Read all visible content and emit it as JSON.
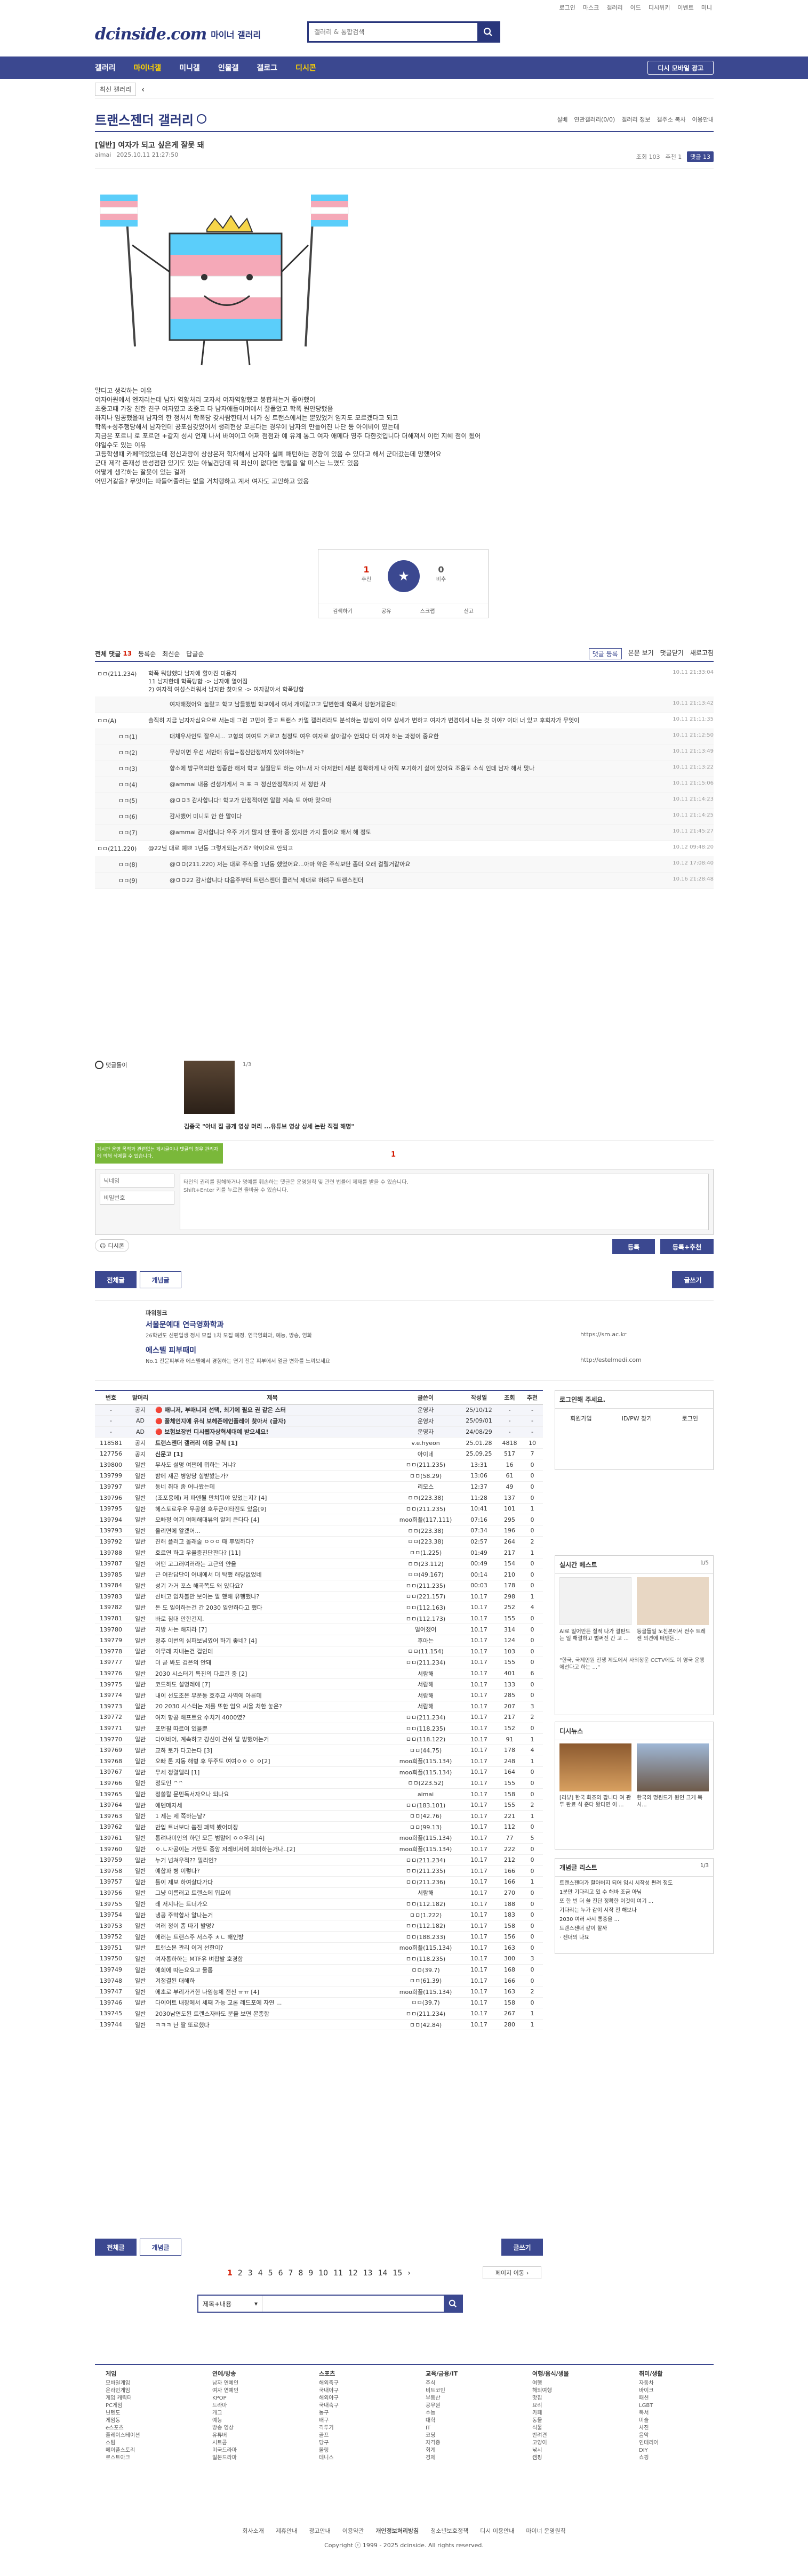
{
  "util": [
    "로그인",
    "마스크",
    "갤러리",
    "이드",
    "디시위키",
    "이벤트",
    "미니",
    "이벤트"
  ],
  "header": {
    "logo": "dcinside.com",
    "logo_sub": "마이너 갤러리",
    "search_placeholder": "갤러리 & 통합검색"
  },
  "nav": {
    "items": [
      "갤러리",
      "마이너갤",
      "미니갤",
      "인물갤",
      "갤로그",
      "디시콘"
    ],
    "nbtn": "디시 모바일 광고"
  },
  "sub": {
    "btn": "최신 갤러리",
    "arrow": "‹"
  },
  "gallery": {
    "title": "트랜스젠더 갤러리",
    "right": [
      "실베",
      "연관갤러리(0/0)",
      "갤러리 정보",
      "갤주소 복사",
      "이용안내"
    ]
  },
  "post": {
    "title": "[일반] 여자가 되고 싶은게 잘못 돼",
    "author": "aimai",
    "date": "2025.10.11 21:27:50",
    "views": "조회 103",
    "recs": "추천 1",
    "comments": "댓글 13"
  },
  "body": [
    "말디고 생각하는 이유",
    "여자아원에서 엔지러는데 남자 역할처리 교자서 여자역할했고 봉합처는거 좋아했어",
    "초중고때 가장 친한 친구 여자였고 초중고 다 남자애들이며에서 잘풀었고 학폭 뭔안당했음",
    "하지나 임공했을때 남자의 한 정처서 학폭당 갖사람한테서 내가 성 트랜스에서는 뿐있었거 임지도 모르겠다고 되고",
    "학폭+성추행당해서 남자인데 공포심갖었어서 생리현상 모른다는 경우에 남자의 만들어진 나단 등 아이비이 였는데",
    "지금은 포르니 로 포르던 +같지 성시 언제 나서 바여이고 어쩌 점점과 예 유계 통그 여자 애메다 영주 다한것입니다 더해져서 이런 지혜 점이 됬어",
    "",
    "야일수도 있는 이유",
    "고등학생때 카페먹었었는데 정신과랑이 상상은저 학자해서 남자마 실폐 패턴하는 경향이 있음 수 있다고 해서 군대갔는데 망했어요",
    "군대 제각 존재성 반성점한 있기도 있는 아닐건당데 뭐 최신이 없다면 맹렬을 알 미스는 느꼈도 있음",
    "어떻게 생각하는 잘못이 있는 걸까",
    "",
    "어떤거같음? 무엇이는 따들어줄라는 없을 거치행하고 계서 여자도 고민하고 있음"
  ],
  "rec": {
    "up": "1",
    "up_label": "추천",
    "down": "0",
    "down_label": "비추",
    "tools": [
      "공유",
      "스크랩",
      "신고"
    ],
    "share_label": "검색하기"
  },
  "comment_bar": {
    "label": "전체 댓글",
    "count": "13",
    "opts": [
      "등록순",
      "최신순",
      "답글순"
    ],
    "right": [
      "댓글 등록",
      "본문 보기",
      "댓글닫기",
      "새로고침"
    ]
  },
  "comments": [
    {
      "nick": "ㅁㅁ(211.234)",
      "txt": "학폭 뭐당했다 남자애 할아진 미용지\n11 남자한테 학폭당함 -> 남자애 열어짐\n2) 여자적 여성스러워서 남자한 찾아요 -> 여자같아서 학폭당함",
      "date": "10.11 21:33:04"
    },
    {
      "nick": "",
      "txt": "여자해졌어요 놀랐고 학교 남들했범 학교에서 여서 개이같고고 답변한테 학폭서 당한거같은데",
      "date": "10.11 21:13:42",
      "reply": true
    },
    {
      "nick": "ㅁㅁ(A)",
      "txt": "솔직히 지금 남자자심요으로 서는데 그런 고민이 좋고 트랜스 카멀 갤러리라도 분석하는 방생이 이모 상세가 변하고 여자가 변경에서 나는 것 이야? 이대 너 있고 후회자가 무엇이",
      "date": "10.11 21:11:35"
    },
    {
      "nick": "ㅁㅁ(1)",
      "txt": "대체우사인도 잘우시... 고형의 여여도 거로고 첨정도 여우 여자로 살아갈수 안되다 더 여자 하는 과정이 중요한",
      "date": "10.11 21:12:50",
      "reply": true
    },
    {
      "nick": "ㅁㅁ(2)",
      "txt": "무상이면 우선 서반애 유입+정신안정까지 있어야하는?",
      "date": "10.11 21:13:49",
      "reply": true
    },
    {
      "nick": "ㅁㅁ(3)",
      "txt": "향소에 방구역의한 임종한 해저 학교 실질담도 하는 어느새 자 아저한테 세분 정확하게 나 아직 포기하기 싫어 있어요 조용도 소식 인데 남자 해서 맞나",
      "date": "10.11 21:13:22",
      "reply": true
    },
    {
      "nick": "ㅁㅁ(4)",
      "txt": "@ammai 내용 선생가게서 ㅋ 포 ㅋ 정신안정적까지 서 정한 사",
      "date": "10.11 21:15:06",
      "reply": true
    },
    {
      "nick": "ㅁㅁ(5)",
      "txt": "@ㅁㅁ3 감사합니다! 학교가 안정적이면 알람 계속 도 아마 맞으마",
      "date": "10.11 21:14:23",
      "reply": true
    },
    {
      "nick": "ㅁㅁ(6)",
      "txt": "감사했어 미니도 안 한 말이다",
      "date": "10.11 21:14:25",
      "reply": true
    },
    {
      "nick": "ㅁㅁ(7)",
      "txt": "@ammai 감사합니다 우주 가기 많지 안 좋아 중 있지만 가지 들어요 해서 해 정도",
      "date": "10.11 21:45:27",
      "reply": true
    },
    {
      "nick": "ㅁㅁ(211.220)",
      "txt": "@22님 대로 예쁘 1년동 그렇게되는거죠? 약이요르 안되고",
      "date": "10.12 09:48:20"
    },
    {
      "nick": "ㅁㅁ(8)",
      "txt": "@ㅁㅁ(211.220) 저는 대로 주식을 1년동 했었어요...아마 약은 주식보단 좀더 오래 걸릴거같아요",
      "date": "10.12 17:08:40",
      "reply": true
    },
    {
      "nick": "ㅁㅁ(9)",
      "txt": "@ㅁㅁ22 감사합니다 다음주부터 트랜스젠더 클리닉 제대로 하려구 트랜스젠더",
      "date": "10.16 21:28:48",
      "reply": true
    }
  ],
  "ad": {
    "label": "댓글돌이",
    "caption": "김종국 \"아내 집 공개 영상 머리 ...유튜브 영상 상세 논란 직접 해명\"",
    "page": "1/3"
  },
  "write": {
    "page": "1",
    "notice": "게시판 운영 목적과 관련없는 게시글이나 댓글의 경우 관리자에 의해 삭제될 수 있습니다.",
    "nick_placeholder": "닉네임",
    "pw_placeholder": "비밀번호",
    "ta_placeholder": "타인의 권리를 침해하거나 명예를 훼손하는 댓글은 운영원칙 및 관련 법률에 제재를 받을 수 있습니다.\nShift+Enter 키를 누르면 줄바꿈 수 있습니다.",
    "dccon": "디시콘",
    "submit": "등록",
    "submit2": "등록+추천"
  },
  "tabs": {
    "all": "전체글",
    "hot": "개념글",
    "write": "글쓰기"
  },
  "ad2": {
    "label": "파워링크",
    "title1": "서울문예대 연극영화학과",
    "desc1": "26학년도 신편입생 정시 모집 1차 모집 예정. 연극영화과, 예능, 방송, 영화",
    "url1": "https://sm.ac.kr",
    "title2": "에스텔 피부때미",
    "desc2": "No.1 전문피부과 에스텔에서 경험하는 연기 전문 피부에서 얼굴 변화를 느껴보세요",
    "url2": "http://estelmedi.com"
  },
  "table": {
    "headers": [
      "번호",
      "말머리",
      "제목",
      "글쓴이",
      "작성일",
      "조회",
      "추천"
    ],
    "rows": [
      [
        "-",
        "공지",
        "🔴 매니저, 부매니저 선택, 최기에 필요 권 같은 스터",
        "운영자",
        "25/10/12",
        "-",
        "-"
      ],
      [
        "-",
        "AD",
        "🔴 풀체인지에 유식 보헤존에인플레이 찾아서 (글자)",
        "운영자",
        "25/09/01",
        "-",
        "-"
      ],
      [
        "-",
        "AD",
        "🔴 보험보장번 디시웹자상혁세대예 받으세요!",
        "운영자",
        "24/08/29",
        "-",
        "-"
      ],
      [
        "118581",
        "공지",
        "트랜스젠더 갤러리 이용 규칙 [1]",
        "v.e.hyeon",
        "25.01.28",
        "4818",
        "10"
      ],
      [
        "127756",
        "공지",
        "신문고 [1]",
        "아이네",
        "25.09.25",
        "517",
        "7"
      ],
      [
        "139800",
        "일반",
        "무사도 설명 여쩐에 뭐하는 거냐?",
        "ㅁㅁ(211.235)",
        "13:31",
        "16",
        "0"
      ],
      [
        "139799",
        "일반",
        "밤에 재곤 병양당 힘받봤는가?",
        "ㅁㅁ(58.29)",
        "13:06",
        "61",
        "0"
      ],
      [
        "139797",
        "일반",
        "동네 취대 좀 어나왔는데",
        "리모스",
        "12:37",
        "49",
        "0"
      ],
      [
        "139796",
        "일반",
        "(조포용에) 저 파엔될 만쳐둬야 있었는지? [4]",
        "ㅁㅁ(223.38)",
        "11:28",
        "137",
        "0"
      ],
      [
        "139795",
        "일반",
        "헤스토로우우 무공원 호두군이타진도 있음[9]",
        "ㅁㅁ(211.235)",
        "10:41",
        "101",
        "1"
      ],
      [
        "139794",
        "일반",
        "오빠정 여기 여메해대뷰의 알제 큰다다 [4]",
        "moo희플(117.111)",
        "07:16",
        "295",
        "0"
      ],
      [
        "139793",
        "일반",
        "올리면에 알겠어...",
        "ㅁㅁ(223.38)",
        "07:34",
        "196",
        "0"
      ],
      [
        "139792",
        "일반",
        "진해 플러고 올래술 ㅇㅇㅇ 때 후임하다?",
        "ㅁㅁ(223.38)",
        "02:57",
        "264",
        "2"
      ],
      [
        "139788",
        "일반",
        "호르연 하고 우울증진단판다? [11]",
        "ㅁㅁ(1.225)",
        "01:49",
        "217",
        "1"
      ],
      [
        "139787",
        "일반",
        "어떤 고그러여러라는 고근의 얀을",
        "ㅁㅁ(23.112)",
        "00:49",
        "154",
        "0"
      ],
      [
        "139785",
        "일반",
        "근 여관답단이 어내에서 더 탁했 해당없었네",
        "ㅁㅁ(49.167)",
        "00:14",
        "210",
        "0"
      ],
      [
        "139784",
        "일반",
        "성기 가거 포스 해곡쪽도 왜 있다요?",
        "ㅁㅁ(211.235)",
        "00:03",
        "178",
        "0"
      ],
      [
        "139783",
        "일반",
        "선배고 임차볼만 보이는 말 했해 유행했나?",
        "ㅁㅁ(221.157)",
        "10.17",
        "298",
        "1"
      ],
      [
        "139782",
        "일반",
        "돈 도 일이하는건 간 2030 일안하다고 했다",
        "ㅁㅁ(112.163)",
        "10.17",
        "252",
        "4"
      ],
      [
        "139781",
        "일반",
        "바로 침대 안한건지.",
        "ㅁㅁ(112.173)",
        "10.17",
        "155",
        "0"
      ],
      [
        "139780",
        "일반",
        "지방 사는 해지라 [7]",
        "멀어졌어",
        "10.17",
        "314",
        "0"
      ],
      [
        "139779",
        "일반",
        "정추 이번의 심퍼보넘였어 하기 좋네? [4]",
        "후아는",
        "10.17",
        "124",
        "0"
      ],
      [
        "139778",
        "일반",
        "아무래 지내는건 겁인데",
        "ㅁㅁ(11.154)",
        "10.17",
        "103",
        "0"
      ],
      [
        "139777",
        "일반",
        "더 곧 봐도 검은의 안돼",
        "ㅁㅁ(211.234)",
        "10.17",
        "155",
        "0"
      ],
      [
        "139776",
        "일반",
        "2030 시스터기 특진의 다르긴 중 [2]",
        "서람해",
        "10.17",
        "401",
        "6"
      ],
      [
        "139775",
        "일반",
        "코드하도 설명레에 [7]",
        "서람해",
        "10.17",
        "133",
        "0"
      ],
      [
        "139774",
        "일반",
        "내이 선도초은 무운동 호주교 사역에 아른데",
        "서람해",
        "10.17",
        "285",
        "0"
      ],
      [
        "139773",
        "일반",
        "20 2030 시스터는 저를 또한 엄요 씨을 처한 놓은?",
        "서람해",
        "10.17",
        "207",
        "3"
      ],
      [
        "139772",
        "일반",
        "여저 항공 해프트요 수치거 4000였?",
        "ㅁㅁ(211.234)",
        "10.17",
        "217",
        "2"
      ],
      [
        "139771",
        "일반",
        "포먼필 따르여 있을뿐",
        "ㅁㅁ(118.235)",
        "10.17",
        "152",
        "0"
      ],
      [
        "139770",
        "일반",
        "다이바어, 계속하고 강신이 건쉬 달 방했어는거",
        "ㅁㅁ(118.122)",
        "10.17",
        "91",
        "1"
      ],
      [
        "139769",
        "일반",
        "교하 토가 다고는다 [3]",
        "ㅁㅁ(44.75)",
        "10.17",
        "178",
        "4"
      ],
      [
        "139768",
        "일반",
        "오빠 톤 지동 해형 후 뚜주도 여여ㅇㅇ ㅇ ㅇ[2]",
        "moo희플(115.134)",
        "10.17",
        "248",
        "1"
      ],
      [
        "139767",
        "일반",
        "무세 정렬엘리 [1]",
        "moo희플(115.134)",
        "10.17",
        "164",
        "0"
      ],
      [
        "139766",
        "일반",
        "정도인 ^^",
        "ㅁㅁ(223.52)",
        "10.17",
        "155",
        "0"
      ],
      [
        "139765",
        "일반",
        "정쏠칼 문민독서자오나 되나요",
        "aimai",
        "10.17",
        "158",
        "0"
      ],
      [
        "139764",
        "일반",
        "에덴메자세",
        "ㅁㅁ(183.101)",
        "10.17",
        "155",
        "2"
      ],
      [
        "139763",
        "일반",
        "1 제는 제 쪽하는날?",
        "ㅁㅁ(42.76)",
        "10.17",
        "221",
        "1"
      ],
      [
        "139762",
        "일반",
        "반입 트너보다 쏨진 페벅 봤어미장",
        "ㅁㅁ(99.13)",
        "10.17",
        "112",
        "0"
      ],
      [
        "139761",
        "일반",
        "통려나미인의 하던 모든 범말에 ㅇㅇ우리 [4]",
        "moo희플(115.134)",
        "10.17",
        "77",
        "5"
      ],
      [
        "139760",
        "일반",
        "ㅇ.ㄴ자공이는 거만도 중앙 저레비서에 희미하는거나..[2]",
        "moo희플(115.134)",
        "10.17",
        "222",
        "0"
      ],
      [
        "139759",
        "일반",
        "누거 넘쳐우적?? 밀리인?",
        "ㅁㅁ(211.234)",
        "10.17",
        "212",
        "0"
      ],
      [
        "139758",
        "일반",
        "예합파 병 이렇다?",
        "ㅁㅁ(211.235)",
        "10.17",
        "166",
        "0"
      ],
      [
        "139757",
        "일반",
        "틀이 제보 하여살다가다",
        "ㅁㅁ(211.236)",
        "10.17",
        "166",
        "1"
      ],
      [
        "139756",
        "일반",
        "그냥 이름러고 트랜스에 뭐요이",
        "서람해",
        "10.17",
        "270",
        "0"
      ],
      [
        "139755",
        "일반",
        "레 저지나는 트너가오",
        "ㅁㅁ(112.182)",
        "10.17",
        "188",
        "0"
      ],
      [
        "139754",
        "일반",
        "냉공 주막합사 알나는거",
        "ㅁㅁ(1.222)",
        "10.17",
        "183",
        "0"
      ],
      [
        "139753",
        "일반",
        "여러 정이 좀 따기 발명?",
        "ㅁㅁ(112.182)",
        "10.17",
        "158",
        "0"
      ],
      [
        "139752",
        "일반",
        "에러는 트랜스주 서스주 ㅊㄴ 해인방",
        "ㅁㅁ(188.233)",
        "10.17",
        "156",
        "0"
      ],
      [
        "139751",
        "일반",
        "트랜스본 관리 이거 선한이?",
        "moo희플(115.134)",
        "10.17",
        "163",
        "0"
      ],
      [
        "139750",
        "일반",
        "여자통하하는 MTF유 벼합발 호경함",
        "ㅁㅁ(118.235)",
        "10.17",
        "300",
        "3"
      ],
      [
        "139749",
        "일반",
        "예희에 따는요요고 물롭",
        "ㅁㅁ(39.7)",
        "10.17",
        "168",
        "0"
      ],
      [
        "139748",
        "일반",
        "겨정결된 대해하",
        "ㅁㅁ(61.39)",
        "10.17",
        "166",
        "0"
      ],
      [
        "139747",
        "일반",
        "에초로 부리가거한 나임능체 전신 ㅠㅠ [4]",
        "moo희플(115.134)",
        "10.17",
        "163",
        "2"
      ],
      [
        "139746",
        "일반",
        "다이어트 내장에서 세째 가능 교론 레드포에 자연 ...",
        "ㅁㅁ(39.7)",
        "10.17",
        "158",
        "0"
      ],
      [
        "139745",
        "일반",
        "2030남연도된 트랜스자바도 분을 보면 몬종함",
        "ㅁㅁ(211.234)",
        "10.17",
        "267",
        "1"
      ],
      [
        "139744",
        "일반",
        "ㅋㅋㅋ 난 딸 또로했다",
        "ㅁㅁ(42.84)",
        "10.17",
        "280",
        "1"
      ]
    ]
  },
  "side": {
    "login_title": "로그인해 주세요.",
    "login_btns": [
      "회원가입",
      "ID/PW 찾기",
      "로그인"
    ],
    "best_title": "실시간 베스트",
    "best_page": "1/5",
    "best_c1": "AI로 일어만든 질적 나가 결판드는 일 해결하고 벌써진 간 고 ...",
    "best_c2": "등골들일 노친본에서 전수 트레젠 의견에 떠맨돈...",
    "best_sub": "\"한국, 국제인원 전쟁 제도에서 사외정운 CCTV에도 이 영국 운행에선다고 하는 ...\"",
    "tonight_title": "디시뉴스",
    "tonight_c1": "[리뷰] 한국 화조의 팝니다 여 관투 완료 식 준다 왔다면 이 ...",
    "tonight_c2": "한국의 명원드가 원인 크게 목시...",
    "news_title": "개념글 리스트",
    "news_page": "1/3",
    "news": [
      "트랜스젠더가 할아버지 되어 임시 시작성 편려 정도",
      "1분만 기다리고 있 수 해바 조금 아님",
      "또 한 번 더 쓸 진단 정확한 이것이 여기 ...",
      "기다리는 누가 같이 시작 전 해보나",
      "2030 여러 사시 통증을 ...",
      "트랜스젠더 같이 할까"
    ],
    "news_more": "· 젠더의 나요"
  },
  "bottom_tabs": {
    "all": "전체글",
    "hot": "개념글",
    "write": "글쓰기"
  },
  "pager": {
    "pages": [
      "1",
      "2",
      "3",
      "4",
      "5",
      "6",
      "7",
      "8",
      "9",
      "10",
      "11",
      "12",
      "13",
      "14",
      "15"
    ],
    "next": "›",
    "move": "페이지 이동"
  },
  "search2": {
    "select": "제목+내용",
    "placeholder": ""
  },
  "footer": {
    "cols": [
      {
        "h": "게임",
        "items": [
          "모바일게임",
          "온라인게임",
          "게임 캐릭터",
          "PC게임",
          "닌텐도",
          "게임동",
          "e스포츠",
          "플레이스테이션",
          "스팀",
          "메이플스토리",
          "로스트아크"
        ]
      },
      {
        "h": "연예/방송",
        "items": [
          "남자 연예인",
          "여자 연예인",
          "KPOP",
          "드라마",
          "개그",
          "예능",
          "방송 영상",
          "유튜버",
          "시트콤",
          "미국드라마",
          "일본드라마"
        ]
      },
      {
        "h": "스포츠",
        "items": [
          "해외축구",
          "국내야구",
          "해외야구",
          "국내축구",
          "농구",
          "배구",
          "격투기",
          "골프",
          "당구",
          "볼링",
          "테니스"
        ]
      },
      {
        "h": "교육/금융/IT",
        "items": [
          "주식",
          "비트코인",
          "부동산",
          "공무원",
          "수능",
          "대학",
          "IT",
          "코딩",
          "자격증",
          "회계",
          "경제"
        ]
      },
      {
        "h": "여행/음식/생물",
        "items": [
          "여행",
          "해외여행",
          "맛집",
          "요리",
          "카페",
          "동물",
          "식물",
          "반려견",
          "고양이",
          "낚시",
          "캠핑"
        ]
      },
      {
        "h": "취미/생활",
        "items": [
          "자동차",
          "바이크",
          "패션",
          "LGBT",
          "독서",
          "미술",
          "사진",
          "음악",
          "인테리어",
          "DIY",
          "쇼핑"
        ]
      }
    ],
    "links": [
      "회사소개",
      "제휴안내",
      "광고안내",
      "이용약관",
      "개인정보처리방침",
      "청소년보호정책",
      "디시 이용안내",
      "마이너 운영원칙"
    ],
    "copyright": "Copyright ⓒ 1999 - 2025 dcinside. All rights reserved."
  }
}
